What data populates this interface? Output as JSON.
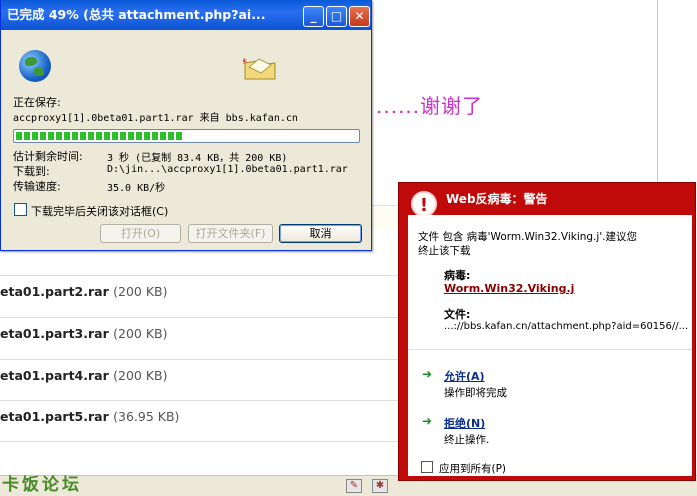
{
  "background": {
    "thanks_text": "......谢谢了",
    "attachments": [
      {
        "name": "eta01.part2.rar",
        "size": "(200 KB)"
      },
      {
        "name": "eta01.part3.rar",
        "size": "(200 KB)"
      },
      {
        "name": "eta01.part4.rar",
        "size": "(200 KB)"
      },
      {
        "name": "eta01.part5.rar",
        "size": "(36.95 KB)"
      }
    ],
    "logo_text": "卡饭论坛"
  },
  "download_dialog": {
    "title": "已完成 49% (总共 attachment.php?ai...",
    "saving_label": "正在保存:",
    "saving_file": "accproxy1[1].0beta01.part1.rar 来自 bbs.kafan.cn",
    "progress_percent": 49,
    "time_left_label": "估计剩余时间:",
    "time_left_value": "3 秒 (已复制 83.4 KB，共 200 KB)",
    "download_to_label": "下载到:",
    "download_to_value": "D:\\jin...\\accproxy1[1].0beta01.part1.rar",
    "rate_label": "传输速度:",
    "rate_value": "35.0 KB/秒",
    "close_checkbox_label": "下载完毕后关闭该对话框(C)",
    "open_button": "打开(O)",
    "open_folder_button": "打开文件夹(F)",
    "cancel_button": "取消"
  },
  "antivirus": {
    "title": "Web反病毒：警告",
    "message_line1": "文件 包含 病毒'Worm.Win32.Viking.j'.建议您",
    "message_line2": "终止该下载",
    "virus_label": "病毒:",
    "virus_name": "Worm.Win32.Viking.j",
    "file_label": "文件:",
    "file_value": "...://bbs.kafan.cn/attachment.php?aid=60156//...",
    "allow_link": "允许(A)",
    "allow_desc": "操作即将完成",
    "deny_link": "拒绝(N)",
    "deny_desc": "终止操作.",
    "apply_all_label": "应用到所有(P)"
  },
  "colors": {
    "av_red": "#c00a0a",
    "xp_blue": "#0b53d1",
    "dialog_face": "#ece9d8",
    "progress_green": "#2cc02c"
  }
}
